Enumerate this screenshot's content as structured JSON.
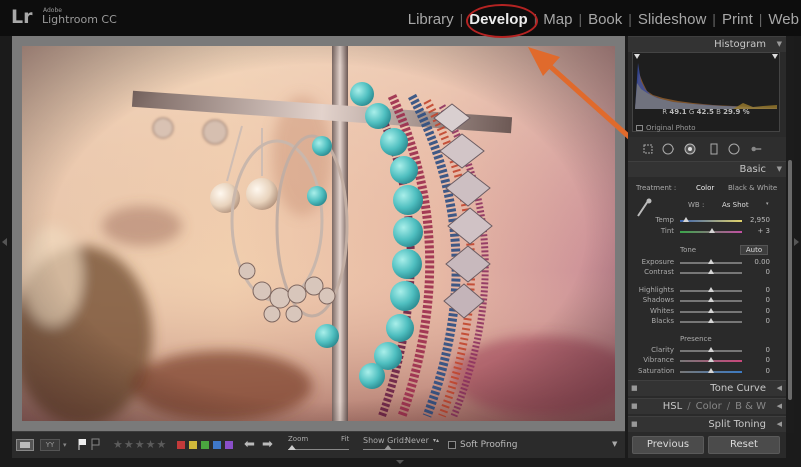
{
  "app": {
    "logo": "Lr",
    "brand_top": "Adobe",
    "brand_name": "Lightroom CC"
  },
  "modules": [
    {
      "label": "Library",
      "active": false
    },
    {
      "label": "Develop",
      "active": true
    },
    {
      "label": "Map",
      "active": false
    },
    {
      "label": "Book",
      "active": false
    },
    {
      "label": "Slideshow",
      "active": false
    },
    {
      "label": "Print",
      "active": false
    },
    {
      "label": "Web",
      "active": false
    }
  ],
  "module_separator": "|",
  "annotation": {
    "color": "#b42322",
    "arrow_color": "#e06a2c"
  },
  "toolbar": {
    "stars": "★★★★★",
    "color_labels": [
      "#c33a3a",
      "#cfb73a",
      "#4aa63f",
      "#3f78c9",
      "#8a4fc9"
    ],
    "zoom_label": "Zoom",
    "zoom_fit": "Fit",
    "show_grid_label": "Show Grid:",
    "show_grid_value": "Never",
    "soft_proofing_label": "Soft Proofing"
  },
  "histogram": {
    "title": "Histogram",
    "r_label": "R",
    "r_value": "49.1",
    "g_label": "G",
    "g_value": "42.5",
    "b_label": "B",
    "b_value": "29.9",
    "unit": "%",
    "original_photo_label": "Original Photo"
  },
  "basic": {
    "title": "Basic",
    "treatment_label": "Treatment :",
    "treatment_color": "Color",
    "treatment_bw": "Black & White",
    "wb_label": "WB :",
    "wb_value": "As Shot",
    "temp_label": "Temp",
    "temp_value": "2,950",
    "tint_label": "Tint",
    "tint_value": "+ 3",
    "tone_label": "Tone",
    "auto_label": "Auto",
    "exposure_label": "Exposure",
    "exposure_value": "0.00",
    "contrast_label": "Contrast",
    "contrast_value": "0",
    "highlights_label": "Highlights",
    "highlights_value": "0",
    "shadows_label": "Shadows",
    "shadows_value": "0",
    "whites_label": "Whites",
    "whites_value": "0",
    "blacks_label": "Blacks",
    "blacks_value": "0",
    "presence_label": "Presence",
    "clarity_label": "Clarity",
    "clarity_value": "0",
    "vibrance_label": "Vibrance",
    "vibrance_value": "0",
    "saturation_label": "Saturation",
    "saturation_value": "0"
  },
  "sections": {
    "tone_curve": "Tone Curve",
    "hsl": "HSL",
    "color": "Color",
    "bw": "B & W",
    "split_toning": "Split Toning"
  },
  "buttons": {
    "previous": "Previous",
    "reset": "Reset"
  }
}
